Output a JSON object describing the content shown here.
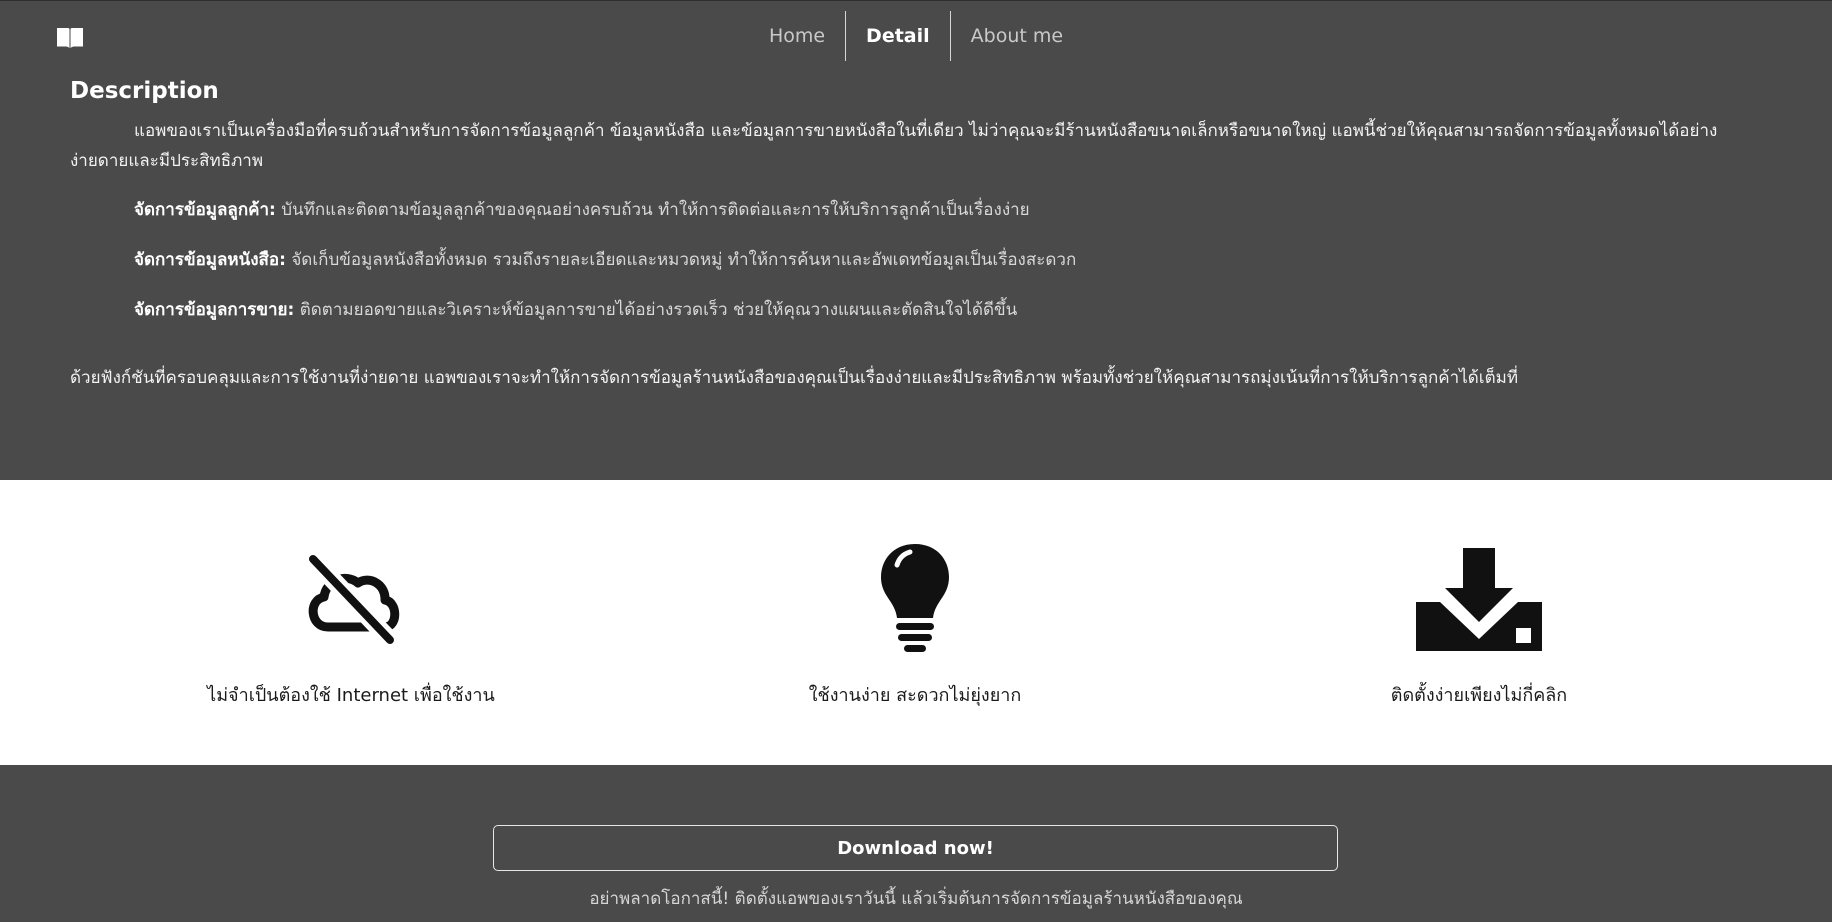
{
  "nav": {
    "logo_icon": "book-open-icon",
    "items": [
      "Home",
      "Detail",
      "About me"
    ],
    "active": "Detail"
  },
  "description": {
    "title": "Description",
    "intro": "แอพของเราเป็นเครื่องมือที่ครบถ้วนสำหรับการจัดการข้อมูลลูกค้า ข้อมูลหนังสือ และข้อมูลการขายหนังสือในที่เดียว ไม่ว่าคุณจะมีร้านหนังสือขนาดเล็กหรือขนาดใหญ่ แอพนี้ช่วยให้คุณสามารถจัดการข้อมูลทั้งหมดได้อย่างง่ายดายและมีประสิทธิภาพ",
    "features": [
      {
        "label": "จัดการข้อมูลลูกค้า:",
        "text": " บันทึกและติดตามข้อมูลลูกค้าของคุณอย่างครบถ้วน ทำให้การติดต่อและการให้บริการลูกค้าเป็นเรื่องง่าย"
      },
      {
        "label": "จัดการข้อมูลหนังสือ:",
        "text": " จัดเก็บข้อมูลหนังสือทั้งหมด รวมถึงรายละเอียดและหมวดหมู่ ทำให้การค้นหาและอัพเดทข้อมูลเป็นเรื่องสะดวก"
      },
      {
        "label": "จัดการข้อมูลการขาย:",
        "text": " ติดตามยอดขายและวิเคราะห์ข้อมูลการขายได้อย่างรวดเร็ว ช่วยให้คุณวางแผนและตัดสินใจได้ดีขึ้น"
      }
    ],
    "outro": "ด้วยฟังก์ชันที่ครอบคลุมและการใช้งานที่ง่ายดาย แอพของเราจะทำให้การจัดการข้อมูลร้านหนังสือของคุณเป็นเรื่องง่ายและมีประสิทธิภาพ พร้อมทั้งช่วยให้คุณสามารถมุ่งเน้นที่การให้บริการลูกค้าได้เต็มที่"
  },
  "benefits": [
    {
      "icon": "cloud-off-icon",
      "caption": "ไม่จำเป็นต้องใช้ Internet เพื่อใช้งาน"
    },
    {
      "icon": "lightbulb-icon",
      "caption": "ใช้งานง่าย สะดวกไม่ยุ่งยาก"
    },
    {
      "icon": "download-icon",
      "caption": "ติดตั้งง่ายเพียงไม่กี่คลิก"
    }
  ],
  "footer": {
    "button_label": "Download now!",
    "tagline": "อย่าพลาดโอกาสนี้! ติดตั้งแอพของเราวันนี้ แล้วเริ่มต้นการจัดการข้อมูลร้านหนังสือของคุณ"
  }
}
